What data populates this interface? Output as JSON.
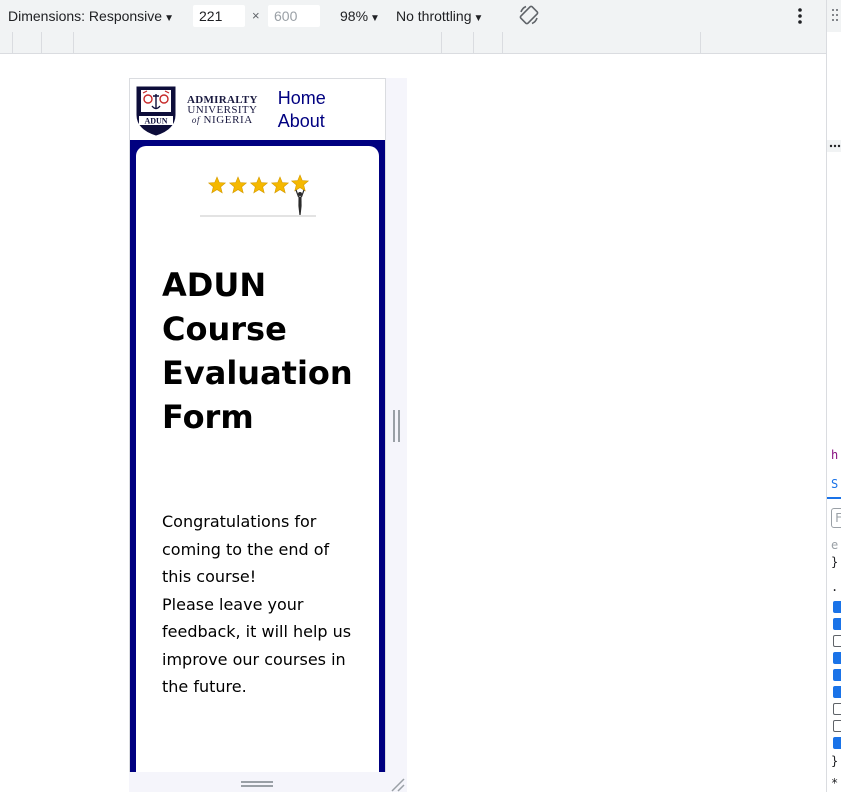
{
  "devtools": {
    "dimensions_label": "Dimensions: Responsive",
    "width_value": "221",
    "height_value": "600",
    "times_symbol": "×",
    "zoom": "98%",
    "throttling": "No throttling",
    "icons": [
      "rotate-icon",
      "more-options-icon"
    ],
    "side_panel": {
      "tab_letter": "h",
      "style_letter": "S",
      "filter_letter": "F",
      "brace": "}",
      "element_prefix": "e.",
      "rule_start": ".",
      "asterisk": "*",
      "checkboxes": [
        true,
        true,
        false,
        true,
        true,
        true,
        false,
        false,
        true
      ]
    }
  },
  "site": {
    "logo": {
      "line1": "ADMIRALTY",
      "line2": "UNIVERSITY",
      "line3_prefix": "of",
      "line3": "NIGERIA",
      "crest_text": "ADUN"
    },
    "nav": [
      {
        "label": "Home"
      },
      {
        "label": "About"
      }
    ],
    "colors": {
      "brand_navy": "#000080",
      "star_gold": "#f5b800"
    },
    "title": "ADUN Course Evaluation Form",
    "intro": {
      "line1": "Congratulations for coming to the end of this course!",
      "line2": "Please leave your feedback, it will help us improve our courses in the future."
    },
    "stars_rating": 5
  }
}
